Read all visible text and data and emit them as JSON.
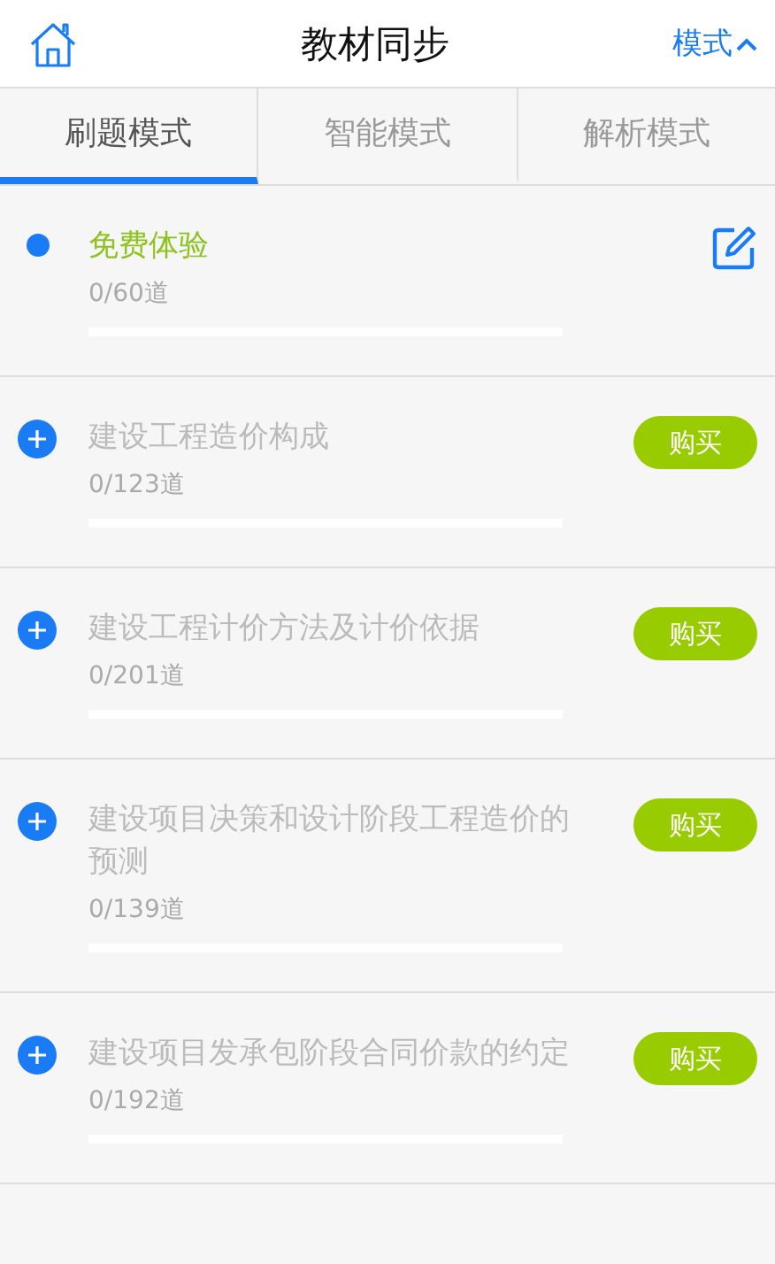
{
  "header": {
    "title": "教材同步",
    "mode_button": "模式"
  },
  "tabs": [
    {
      "label": "刷题模式",
      "selected": true
    },
    {
      "label": "智能模式",
      "selected": false
    },
    {
      "label": "解析模式",
      "selected": false
    }
  ],
  "items": [
    {
      "kind": "free",
      "title": "免费体验",
      "count": "0/60道",
      "level": 0
    },
    {
      "kind": "locked",
      "title": "建设工程造价构成",
      "count": "0/123道",
      "level": 0,
      "button": "购买"
    },
    {
      "kind": "locked",
      "title": "建设工程计价方法及计价依据",
      "count": "0/201道",
      "level": 0,
      "button": "购买"
    },
    {
      "kind": "locked",
      "title": "建设项目决策和设计阶段工程造价的预测",
      "count": "0/139道",
      "level": 0,
      "button": "购买"
    },
    {
      "kind": "locked",
      "title": "建设项目发承包阶段合同价款的约定",
      "count": "0/192道",
      "level": 0,
      "button": "购买"
    }
  ]
}
